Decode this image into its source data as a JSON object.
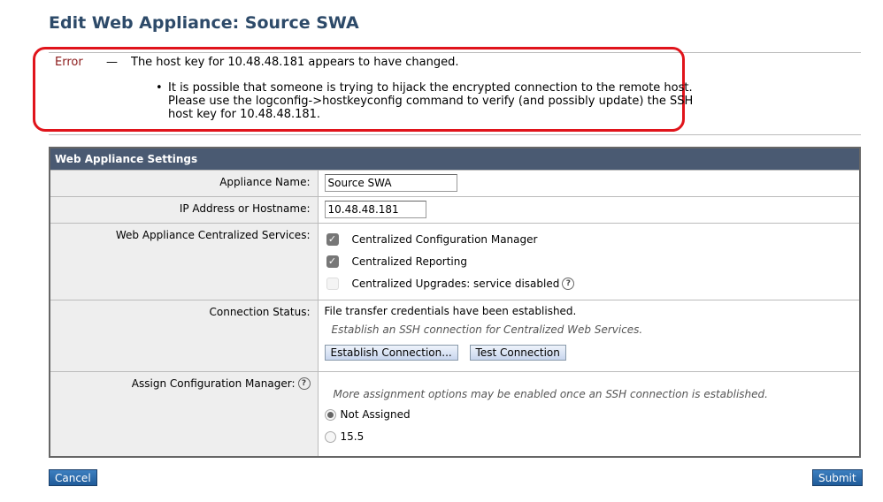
{
  "title": "Edit Web Appliance: Source SWA",
  "error": {
    "label": "Error",
    "dash": "—",
    "message": "The host key for 10.48.48.181 appears to have changed.",
    "details": [
      "It is possible that someone is trying to hijack the encrypted connection to the remote host.",
      "Please use the logconfig->hostkeyconfig command to verify (and possibly update) the SSH",
      "host key for 10.48.48.181."
    ]
  },
  "table": {
    "header": "Web Appliance Settings",
    "name_label": "Appliance Name:",
    "name_value": "Source SWA",
    "ip_label": "IP Address or Hostname:",
    "ip_value": "10.48.48.181",
    "services_label": "Web Appliance Centralized Services:",
    "services": [
      {
        "label": "Centralized Configuration Manager",
        "checked": true
      },
      {
        "label": "Centralized Reporting",
        "checked": true
      },
      {
        "label": "Centralized Upgrades: service disabled",
        "checked": false
      }
    ],
    "status_label": "Connection Status:",
    "status_text": "File transfer credentials have been established.",
    "status_hint": "Establish an SSH connection for Centralized Web Services.",
    "establish_btn": "Establish Connection...",
    "test_btn": "Test Connection",
    "assign_label": "Assign Configuration Manager:",
    "assign_hint": "More assignment options may be enabled once an SSH connection is established.",
    "assign_options": [
      {
        "label": "Not Assigned",
        "selected": true
      },
      {
        "label": "15.5",
        "selected": false
      }
    ]
  },
  "buttons": {
    "cancel": "Cancel",
    "submit": "Submit"
  }
}
